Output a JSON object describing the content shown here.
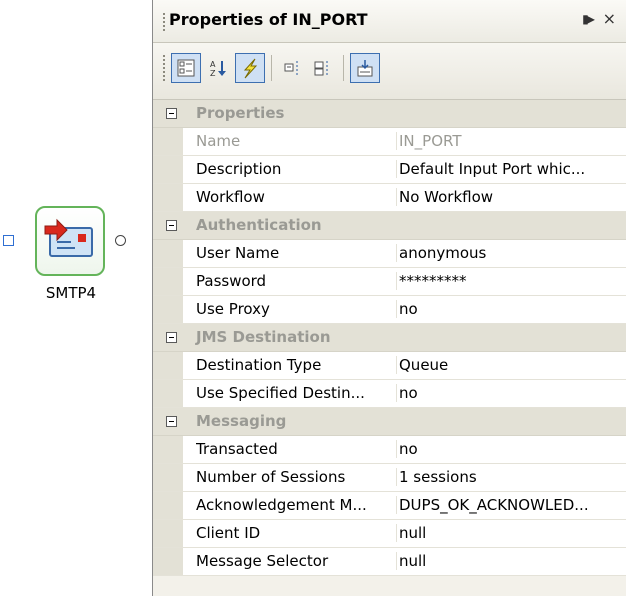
{
  "canvas": {
    "node_label": "SMTP4"
  },
  "panel": {
    "title": "Properties of IN_PORT",
    "pin_glyph": "▶",
    "close_glyph": "×"
  },
  "toolbar": {
    "categorized_icon": "categorized-icon",
    "alphabetical_icon": "sort-az-icon",
    "events_icon": "lightning-icon",
    "expand_icon": "expand-icon",
    "collapse_icon": "collapse-icon",
    "pages_icon": "property-pages-icon"
  },
  "categories": [
    {
      "label": "Properties",
      "rows": [
        {
          "name": "Name",
          "value": "IN_PORT",
          "disabled": true
        },
        {
          "name": "Description",
          "value": "Default Input Port whic..."
        },
        {
          "name": "Workflow",
          "value": "No Workflow"
        }
      ]
    },
    {
      "label": "Authentication",
      "rows": [
        {
          "name": "User Name",
          "value": "anonymous"
        },
        {
          "name": "Password",
          "value": "*********"
        },
        {
          "name": "Use Proxy",
          "value": "no"
        }
      ]
    },
    {
      "label": "JMS Destination",
      "rows": [
        {
          "name": "Destination Type",
          "value": "Queue"
        },
        {
          "name": "Use Specified Destin...",
          "value": "no"
        }
      ]
    },
    {
      "label": "Messaging",
      "rows": [
        {
          "name": "Transacted",
          "value": "no"
        },
        {
          "name": "Number of Sessions",
          "value": "1 sessions"
        },
        {
          "name": "Acknowledgement M...",
          "value": "DUPS_OK_ACKNOWLED..."
        },
        {
          "name": "Client ID",
          "value": "null"
        },
        {
          "name": "Message Selector",
          "value": "null"
        }
      ]
    }
  ]
}
